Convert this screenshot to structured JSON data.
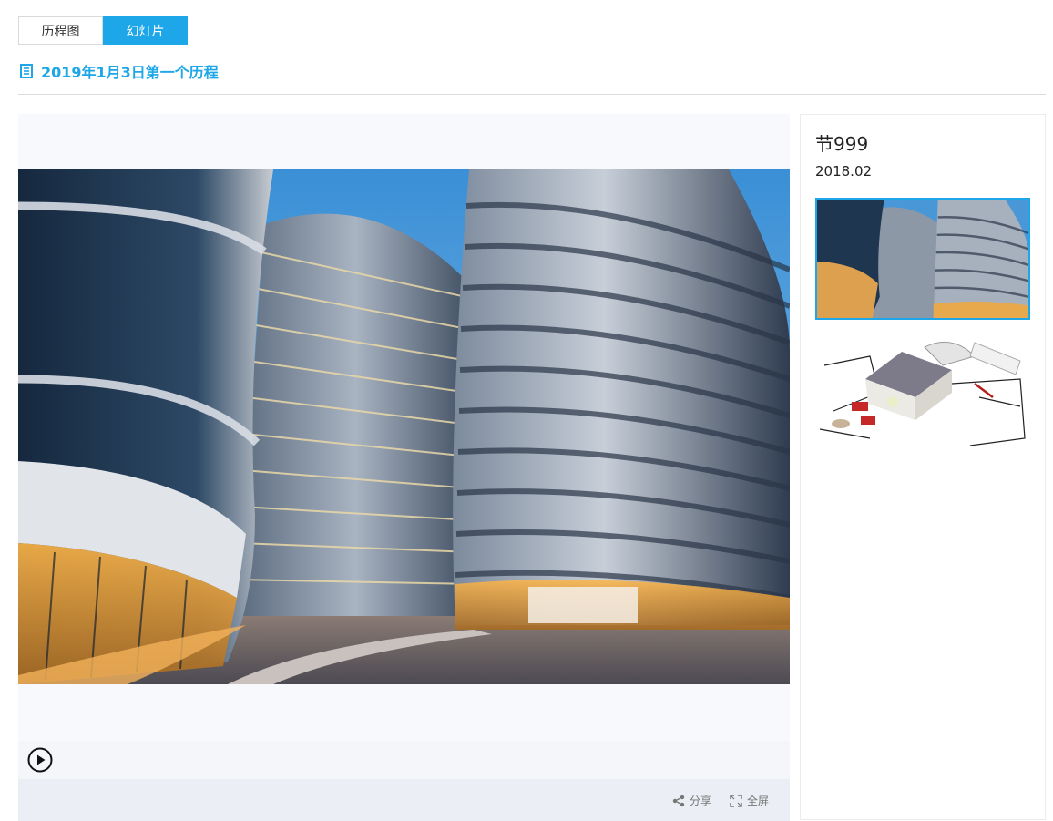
{
  "tabs": [
    {
      "label": "历程图",
      "active": false
    },
    {
      "label": "幻灯片",
      "active": true
    }
  ],
  "heading": {
    "title": "2019年1月3日第一个历程",
    "icon": "document-list-icon"
  },
  "slide": {
    "image": "photo-curved-glass-towers",
    "play_icon": "play-circle-icon"
  },
  "footer": {
    "share_label": "分享",
    "share_icon": "share-icon",
    "fullscreen_label": "全屏",
    "fullscreen_icon": "fullscreen-icon"
  },
  "side": {
    "title": "节999",
    "date": "2018.02",
    "thumbnails": [
      {
        "image": "thumbnail-curved-towers",
        "selected": true
      },
      {
        "image": "thumbnail-house-blueprint",
        "selected": false
      }
    ]
  },
  "colors": {
    "accent": "#1da7e8"
  }
}
